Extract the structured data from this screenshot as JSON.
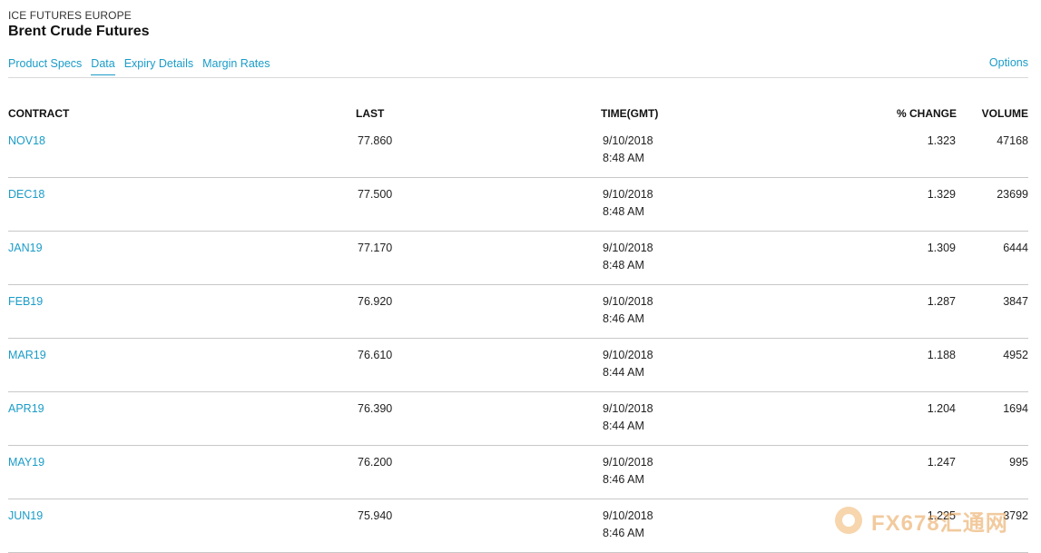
{
  "header": {
    "eyebrow": "ICE FUTURES EUROPE",
    "title": "Brent Crude Futures"
  },
  "tabs": [
    {
      "label": "Product Specs",
      "active": false
    },
    {
      "label": "Data",
      "active": true
    },
    {
      "label": "Expiry Details",
      "active": false
    },
    {
      "label": "Margin Rates",
      "active": false
    }
  ],
  "options_label": "Options",
  "table": {
    "columns": [
      "CONTRACT",
      "LAST",
      "TIME(GMT)",
      "% CHANGE",
      "VOLUME"
    ],
    "rows": [
      {
        "contract": "NOV18",
        "last": "77.860",
        "date": "9/10/2018",
        "time": "8:48 AM",
        "change": "1.323",
        "volume": "47168"
      },
      {
        "contract": "DEC18",
        "last": "77.500",
        "date": "9/10/2018",
        "time": "8:48 AM",
        "change": "1.329",
        "volume": "23699"
      },
      {
        "contract": "JAN19",
        "last": "77.170",
        "date": "9/10/2018",
        "time": "8:48 AM",
        "change": "1.309",
        "volume": "6444"
      },
      {
        "contract": "FEB19",
        "last": "76.920",
        "date": "9/10/2018",
        "time": "8:46 AM",
        "change": "1.287",
        "volume": "3847"
      },
      {
        "contract": "MAR19",
        "last": "76.610",
        "date": "9/10/2018",
        "time": "8:44 AM",
        "change": "1.188",
        "volume": "4952"
      },
      {
        "contract": "APR19",
        "last": "76.390",
        "date": "9/10/2018",
        "time": "8:44 AM",
        "change": "1.204",
        "volume": "1694"
      },
      {
        "contract": "MAY19",
        "last": "76.200",
        "date": "9/10/2018",
        "time": "8:46 AM",
        "change": "1.247",
        "volume": "995"
      },
      {
        "contract": "JUN19",
        "last": "75.940",
        "date": "9/10/2018",
        "time": "8:46 AM",
        "change": "1.225",
        "volume": "3792"
      }
    ]
  },
  "watermark": {
    "text": "FX678汇通网",
    "icon": "watermark-logo-icon"
  },
  "colors": {
    "accent": "#1a9cc8",
    "rule": "#c8c8c8",
    "text": "#1a1a1a"
  }
}
